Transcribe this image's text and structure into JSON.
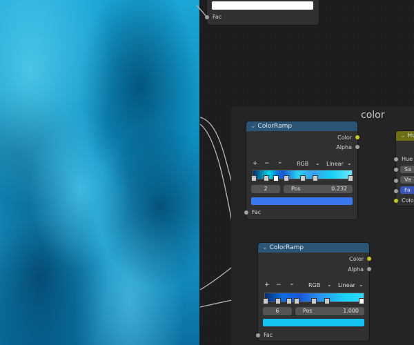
{
  "top_node": {
    "socket_label": "Fac"
  },
  "frame": {
    "label": "color"
  },
  "ramp1": {
    "title": "ColorRamp",
    "out_color": "Color",
    "out_alpha": "Alpha",
    "tools": {
      "add": "+",
      "remove": "−",
      "menu": "⌄"
    },
    "color_mode": "RGB",
    "interpolation": "Linear",
    "stop_index": "2",
    "pos_label": "Pos",
    "pos_value": "0.232",
    "swatch_color": "#3a78f0",
    "in_fac": "Fac"
  },
  "ramp2": {
    "title": "ColorRamp",
    "out_color": "Color",
    "out_alpha": "Alpha",
    "tools": {
      "add": "+",
      "remove": "−",
      "menu": "⌄"
    },
    "color_mode": "RGB",
    "interpolation": "Linear",
    "stop_index": "6",
    "pos_label": "Pos",
    "pos_value": "1.000",
    "swatch_color": "#14c2f2",
    "in_fac": "Fac"
  },
  "hue_node": {
    "title": "Hu",
    "inputs": [
      "Hue",
      "Sa",
      "Va",
      "Fa",
      "Color"
    ]
  },
  "colors": {
    "node_header": "#2a5577",
    "hue_header": "#6e6e14",
    "socket_color": "#c7c729",
    "socket_float": "#a1a1a1"
  }
}
